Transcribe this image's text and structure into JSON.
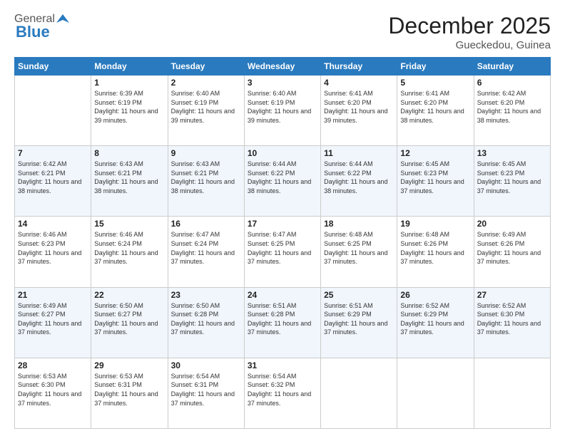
{
  "logo": {
    "general": "General",
    "blue": "Blue"
  },
  "title": "December 2025",
  "location": "Gueckedou, Guinea",
  "days_header": [
    "Sunday",
    "Monday",
    "Tuesday",
    "Wednesday",
    "Thursday",
    "Friday",
    "Saturday"
  ],
  "weeks": [
    [
      {
        "day": "",
        "info": ""
      },
      {
        "day": "1",
        "info": "Sunrise: 6:39 AM\nSunset: 6:19 PM\nDaylight: 11 hours and 39 minutes."
      },
      {
        "day": "2",
        "info": "Sunrise: 6:40 AM\nSunset: 6:19 PM\nDaylight: 11 hours and 39 minutes."
      },
      {
        "day": "3",
        "info": "Sunrise: 6:40 AM\nSunset: 6:19 PM\nDaylight: 11 hours and 39 minutes."
      },
      {
        "day": "4",
        "info": "Sunrise: 6:41 AM\nSunset: 6:20 PM\nDaylight: 11 hours and 39 minutes."
      },
      {
        "day": "5",
        "info": "Sunrise: 6:41 AM\nSunset: 6:20 PM\nDaylight: 11 hours and 38 minutes."
      },
      {
        "day": "6",
        "info": "Sunrise: 6:42 AM\nSunset: 6:20 PM\nDaylight: 11 hours and 38 minutes."
      }
    ],
    [
      {
        "day": "7",
        "info": "Sunrise: 6:42 AM\nSunset: 6:21 PM\nDaylight: 11 hours and 38 minutes."
      },
      {
        "day": "8",
        "info": "Sunrise: 6:43 AM\nSunset: 6:21 PM\nDaylight: 11 hours and 38 minutes."
      },
      {
        "day": "9",
        "info": "Sunrise: 6:43 AM\nSunset: 6:21 PM\nDaylight: 11 hours and 38 minutes."
      },
      {
        "day": "10",
        "info": "Sunrise: 6:44 AM\nSunset: 6:22 PM\nDaylight: 11 hours and 38 minutes."
      },
      {
        "day": "11",
        "info": "Sunrise: 6:44 AM\nSunset: 6:22 PM\nDaylight: 11 hours and 38 minutes."
      },
      {
        "day": "12",
        "info": "Sunrise: 6:45 AM\nSunset: 6:23 PM\nDaylight: 11 hours and 37 minutes."
      },
      {
        "day": "13",
        "info": "Sunrise: 6:45 AM\nSunset: 6:23 PM\nDaylight: 11 hours and 37 minutes."
      }
    ],
    [
      {
        "day": "14",
        "info": "Sunrise: 6:46 AM\nSunset: 6:23 PM\nDaylight: 11 hours and 37 minutes."
      },
      {
        "day": "15",
        "info": "Sunrise: 6:46 AM\nSunset: 6:24 PM\nDaylight: 11 hours and 37 minutes."
      },
      {
        "day": "16",
        "info": "Sunrise: 6:47 AM\nSunset: 6:24 PM\nDaylight: 11 hours and 37 minutes."
      },
      {
        "day": "17",
        "info": "Sunrise: 6:47 AM\nSunset: 6:25 PM\nDaylight: 11 hours and 37 minutes."
      },
      {
        "day": "18",
        "info": "Sunrise: 6:48 AM\nSunset: 6:25 PM\nDaylight: 11 hours and 37 minutes."
      },
      {
        "day": "19",
        "info": "Sunrise: 6:48 AM\nSunset: 6:26 PM\nDaylight: 11 hours and 37 minutes."
      },
      {
        "day": "20",
        "info": "Sunrise: 6:49 AM\nSunset: 6:26 PM\nDaylight: 11 hours and 37 minutes."
      }
    ],
    [
      {
        "day": "21",
        "info": "Sunrise: 6:49 AM\nSunset: 6:27 PM\nDaylight: 11 hours and 37 minutes."
      },
      {
        "day": "22",
        "info": "Sunrise: 6:50 AM\nSunset: 6:27 PM\nDaylight: 11 hours and 37 minutes."
      },
      {
        "day": "23",
        "info": "Sunrise: 6:50 AM\nSunset: 6:28 PM\nDaylight: 11 hours and 37 minutes."
      },
      {
        "day": "24",
        "info": "Sunrise: 6:51 AM\nSunset: 6:28 PM\nDaylight: 11 hours and 37 minutes."
      },
      {
        "day": "25",
        "info": "Sunrise: 6:51 AM\nSunset: 6:29 PM\nDaylight: 11 hours and 37 minutes."
      },
      {
        "day": "26",
        "info": "Sunrise: 6:52 AM\nSunset: 6:29 PM\nDaylight: 11 hours and 37 minutes."
      },
      {
        "day": "27",
        "info": "Sunrise: 6:52 AM\nSunset: 6:30 PM\nDaylight: 11 hours and 37 minutes."
      }
    ],
    [
      {
        "day": "28",
        "info": "Sunrise: 6:53 AM\nSunset: 6:30 PM\nDaylight: 11 hours and 37 minutes."
      },
      {
        "day": "29",
        "info": "Sunrise: 6:53 AM\nSunset: 6:31 PM\nDaylight: 11 hours and 37 minutes."
      },
      {
        "day": "30",
        "info": "Sunrise: 6:54 AM\nSunset: 6:31 PM\nDaylight: 11 hours and 37 minutes."
      },
      {
        "day": "31",
        "info": "Sunrise: 6:54 AM\nSunset: 6:32 PM\nDaylight: 11 hours and 37 minutes."
      },
      {
        "day": "",
        "info": ""
      },
      {
        "day": "",
        "info": ""
      },
      {
        "day": "",
        "info": ""
      }
    ]
  ]
}
